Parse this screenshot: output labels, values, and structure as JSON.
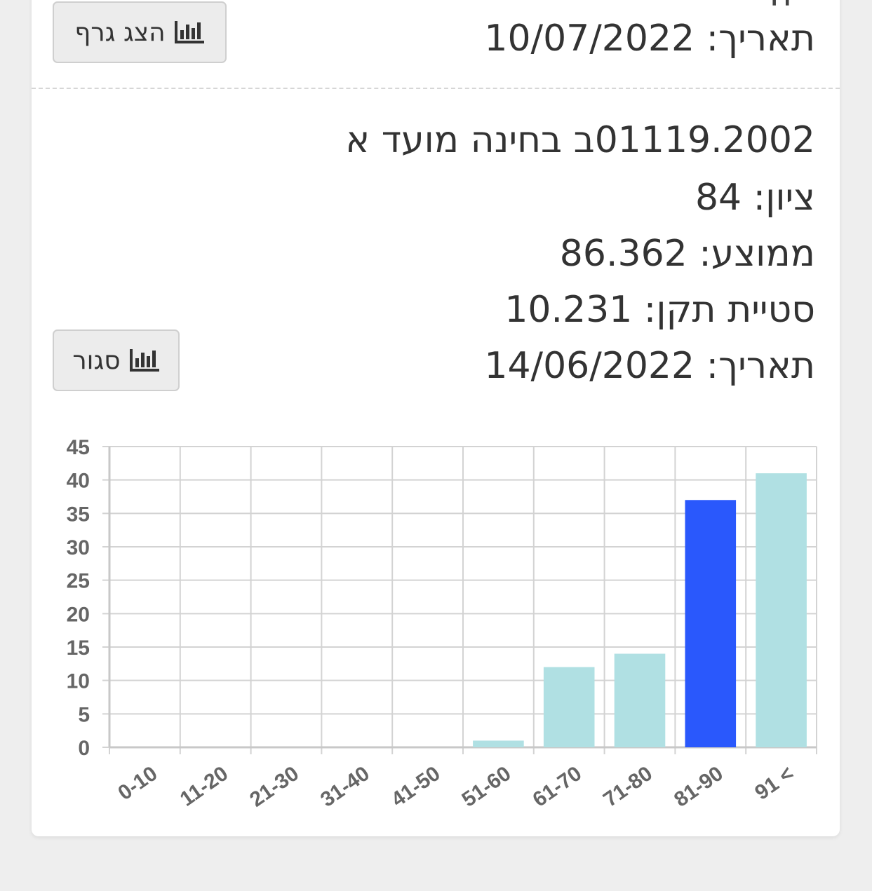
{
  "previous_item": {
    "date_line": "תאריך: 10/07/2022",
    "button_label": "הצג גרף",
    "button_icon": "bar-chart-icon"
  },
  "current_item": {
    "title": "01119.2002ב בחינה מועד א",
    "grade_line": "ציון: 84",
    "average_line": "ממוצע: 86.362",
    "stddev_line": "סטיית תקן: 10.231",
    "date_line": "תאריך: 14/06/2022",
    "button_label": "סגור",
    "button_icon": "bar-chart-icon"
  },
  "colors": {
    "bar": "#b0e0e3",
    "highlight_bar": "#2a58fc",
    "grid": "#d3d3d3",
    "axis_text": "#666666"
  },
  "chart_data": {
    "type": "bar",
    "categories": [
      "0-10",
      "11-20",
      "21-30",
      "31-40",
      "41-50",
      "51-60",
      "61-70",
      "71-80",
      "81-90",
      "91 <"
    ],
    "values": [
      0,
      0,
      0,
      0,
      0,
      1,
      12,
      14,
      37,
      41
    ],
    "highlight_category": "81-90",
    "ylim": [
      0,
      45
    ],
    "yticks": [
      0,
      5,
      10,
      15,
      20,
      25,
      30,
      35,
      40,
      45
    ],
    "grid": true,
    "legend": "none"
  }
}
